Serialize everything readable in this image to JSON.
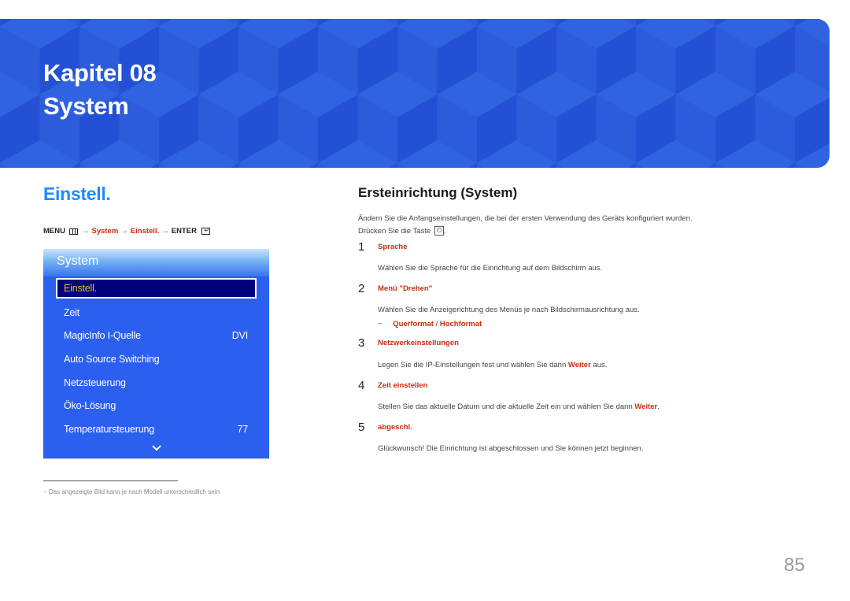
{
  "banner": {
    "chapter": "Kapitel 08",
    "title": "System",
    "colors": {
      "base": "#2c5cdc",
      "light": "#3063df",
      "dark": "#2450d6"
    }
  },
  "left": {
    "section_title": "Einstell.",
    "menu_path": {
      "menu": "MENU",
      "menu_icon": "menu-icon",
      "arrow": "→",
      "step1": "System",
      "step2": "Einstell.",
      "enter": "ENTER",
      "enter_icon": "enter-icon"
    },
    "osd": {
      "header": "System",
      "items": [
        {
          "label": "Einstell.",
          "value": "",
          "selected": true
        },
        {
          "label": "Zeit",
          "value": ""
        },
        {
          "label": "MagicInfo I-Quelle",
          "value": "DVI"
        },
        {
          "label": "Auto Source Switching",
          "value": ""
        },
        {
          "label": "Netzsteuerung",
          "value": ""
        },
        {
          "label": "Öko-Lösung",
          "value": ""
        },
        {
          "label": "Temperatursteuerung",
          "value": "77"
        }
      ],
      "more_icon": "chevron-down-icon"
    },
    "footnote": {
      "dash": "−",
      "text": "Das angezeigte Bild kann je nach Modell unterschiedlich sein."
    }
  },
  "right": {
    "title": "Ersteinrichtung (System)",
    "intro_line1": "Ändern Sie die Anfangseinstellungen, die bei der ersten Verwendung des Geräts konfiguriert wurden.",
    "intro_line2": "Drücken Sie die Taste",
    "intro_key_icon": "power-icon",
    "intro_end": ".",
    "steps": [
      {
        "num": "1",
        "title": "Sprache",
        "desc": "Wählen Sie die Sprache für die Einrichtung auf dem Bildschirm aus."
      },
      {
        "num": "2",
        "title": "Menü \"Drehen\"",
        "desc": "Wählen Sie die Anzeigerichtung des Menüs je nach Bildschirmausrichtung aus.",
        "options": {
          "dash": "−",
          "opt1": "Querformat",
          "sep": " / ",
          "opt2": "Hochformat"
        }
      },
      {
        "num": "3",
        "title": "Netzwerkeinstellungen",
        "desc_pre": "Legen Sie die IP-Einstellungen fest und wählen Sie dann ",
        "desc_bold": "Weiter",
        "desc_post": " aus."
      },
      {
        "num": "4",
        "title": "Zeit einstellen",
        "desc_pre": "Stellen Sie das aktuelle Datum und die aktuelle Zeit ein und wählen Sie dann ",
        "desc_bold": "Weiter",
        "desc_post": "."
      },
      {
        "num": "5",
        "title": "abgeschl.",
        "desc": "Glückwunsch! Die Einrichtung ist abgeschlossen und Sie können jetzt beginnen."
      }
    ]
  },
  "page_number": "85",
  "colors": {
    "accent_blue": "#1e8aff",
    "accent_red": "#cc2c0e",
    "osd_blue": "#2a5fef",
    "osd_selected": "#00007d",
    "osd_selected_text": "#f4b63b"
  }
}
